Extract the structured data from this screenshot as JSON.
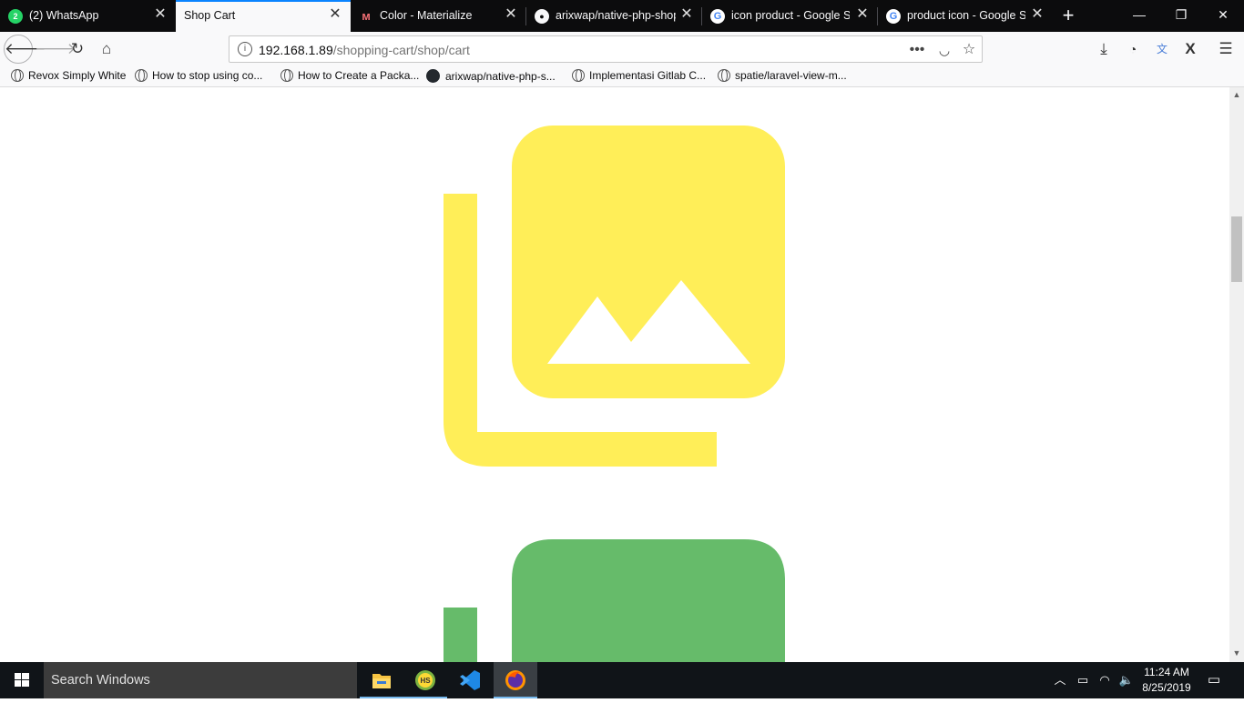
{
  "tabs": [
    {
      "title": "(2) WhatsApp",
      "icon": "whatsapp-icon",
      "badge": "2",
      "active": false
    },
    {
      "title": "Shop Cart",
      "icon": "none",
      "active": true
    },
    {
      "title": "Color - Materialize",
      "icon": "materialize-icon",
      "active": false
    },
    {
      "title": "arixwap/native-php-shop",
      "icon": "github-icon",
      "active": false
    },
    {
      "title": "icon product - Google Se",
      "icon": "google-icon",
      "active": false
    },
    {
      "title": "product icon - Google Se",
      "icon": "google-icon",
      "active": false
    }
  ],
  "navbar": {
    "url_host": "192.168.1.89",
    "url_path": "/shopping-cart/shop/cart"
  },
  "bookmarks": [
    {
      "label": "Revox Simply White",
      "icon": "globe-icon"
    },
    {
      "label": "How to stop using co...",
      "icon": "globe-icon"
    },
    {
      "label": "How to Create a Packa...",
      "icon": "globe-icon"
    },
    {
      "label": "arixwap/native-php-s...",
      "icon": "github-icon"
    },
    {
      "label": "Implementasi Gitlab C...",
      "icon": "globe-icon"
    },
    {
      "label": "spatie/laravel-view-m...",
      "icon": "globe-icon"
    }
  ],
  "content": {
    "product_images": [
      {
        "icon": "photo-library-icon",
        "color": "#ffee58"
      },
      {
        "icon": "photo-library-icon",
        "color": "#66bb6a"
      }
    ]
  },
  "taskbar": {
    "search_placeholder": "Search Windows",
    "apps": [
      "file-explorer-icon",
      "hs-app-icon",
      "vscode-icon",
      "firefox-icon"
    ],
    "clock_time": "11:24 AM",
    "clock_date": "8/25/2019"
  },
  "colors": {
    "accent": "#0a84ff",
    "yellow_icon": "#ffee58",
    "green_icon": "#66bb6a"
  }
}
